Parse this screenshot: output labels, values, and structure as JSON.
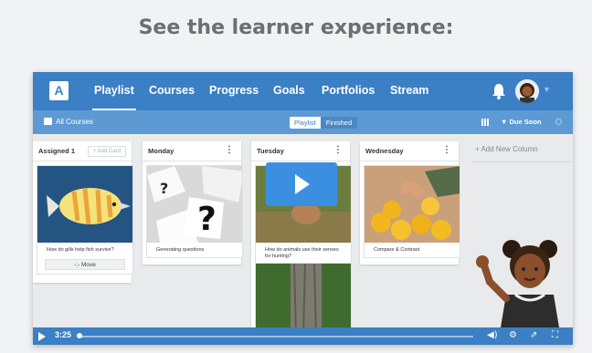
{
  "headline": "See the learner experience:",
  "topbar": {
    "logo": "A",
    "nav": [
      "Playlist",
      "Courses",
      "Progress",
      "Goals",
      "Portfolios",
      "Stream"
    ],
    "active": "Playlist",
    "icons": [
      "bell-icon",
      "user-avatar"
    ]
  },
  "subbar": {
    "all_courses": "All Courses",
    "toggle": {
      "on": "Playlist",
      "off": "Finished"
    },
    "due_soon": "Due Soon"
  },
  "columns": [
    {
      "title": "Assigned 1",
      "action": "+ Add Card",
      "cards": [
        {
          "caption": "How do gills help fish survive?",
          "button": "-:- Move"
        }
      ]
    },
    {
      "title": "Monday",
      "cards": [
        {
          "caption": "Generating questions"
        }
      ]
    },
    {
      "title": "Tuesday",
      "cards": [
        {
          "caption": "How do animals use their senses for hunting?"
        },
        {
          "caption": ""
        }
      ]
    },
    {
      "title": "Wednesday",
      "cards": [
        {
          "caption": "Compare & Contrast"
        }
      ]
    }
  ],
  "add_column": "+ Add New Column",
  "video": {
    "time": "3:25",
    "progress": 0.01
  },
  "colors": {
    "brand": "#3b7fc4",
    "subbar": "#5d9ad3",
    "play": "#3b8fe0"
  }
}
